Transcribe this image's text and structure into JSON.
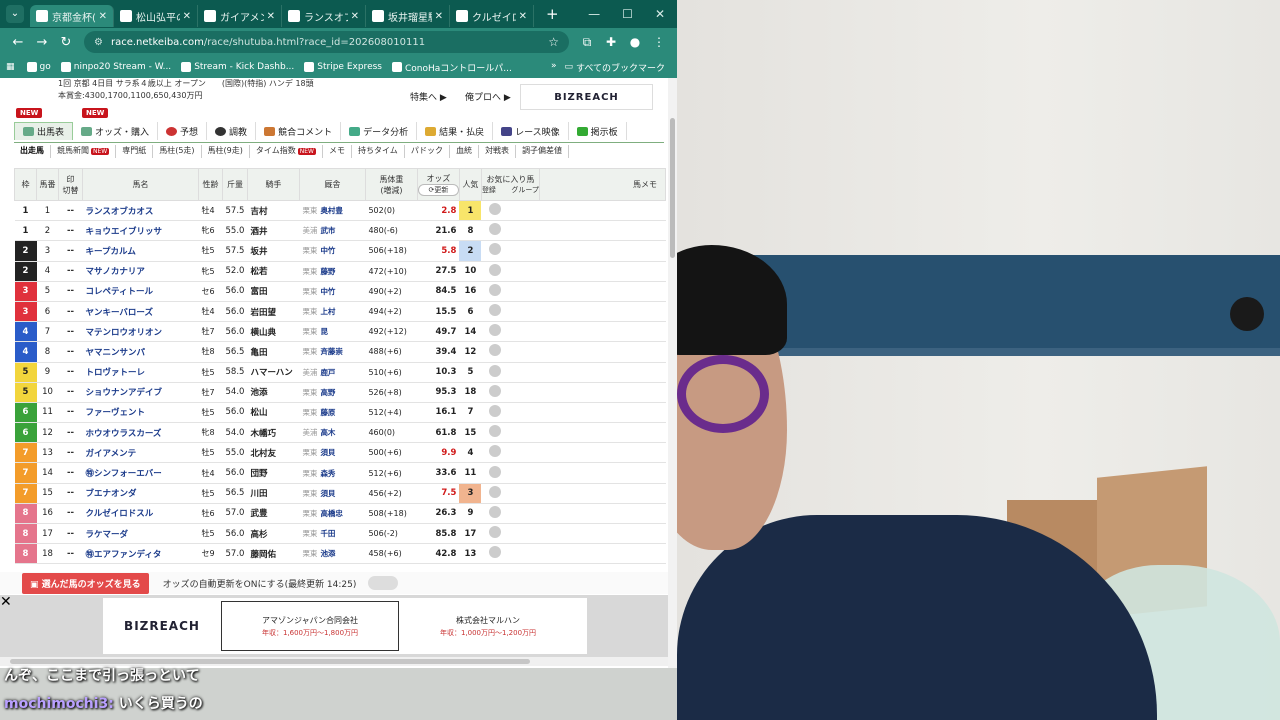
{
  "browser": {
    "tabs": [
      {
        "label": "京都金杯(G"
      },
      {
        "label": "松山弘平のS"
      },
      {
        "label": "ガイアメンテ"
      },
      {
        "label": "ランスオブカオ"
      },
      {
        "label": "坂井瑠星騎手"
      },
      {
        "label": "クルゼイロドス"
      }
    ],
    "url_host": "race.netkeiba.com",
    "url_path": "/race/shutuba.html?race_id=202608010111",
    "bookmarks": [
      {
        "label": "go"
      },
      {
        "label": "ninpo20 Stream - W..."
      },
      {
        "label": "Stream - Kick Dashb..."
      },
      {
        "label": "Stripe Express"
      },
      {
        "label": "ConoHaコントロールパ..."
      }
    ],
    "bookmarks_all": "すべてのブックマーク"
  },
  "race": {
    "info_line1": "1回 京都 4日目 サラ系４歳以上 オープン　　(国際)(特指) ハンデ 18頭",
    "info_line2": "本賞金:4300,1700,1100,650,430万円",
    "tokushu": "特集へ ▶",
    "orepro": "俺プロへ ▶",
    "ad_logo": "BIZREACH"
  },
  "menu_primary": [
    {
      "label": "出馬表"
    },
    {
      "label": "オッズ・購入"
    },
    {
      "label": "予想"
    },
    {
      "label": "調教"
    },
    {
      "label": "競合コメント"
    },
    {
      "label": "データ分析"
    },
    {
      "label": "結果・払戻"
    },
    {
      "label": "レース映像"
    },
    {
      "label": "掲示板"
    }
  ],
  "menu_secondary": [
    {
      "label": "出走馬"
    },
    {
      "label": "競馬新聞"
    },
    {
      "label": "専門紙"
    },
    {
      "label": "馬柱(5走)"
    },
    {
      "label": "馬柱(9走)"
    },
    {
      "label": "タイム指数"
    },
    {
      "label": "メモ"
    },
    {
      "label": "持ちタイム"
    },
    {
      "label": "パドック"
    },
    {
      "label": "血統"
    },
    {
      "label": "対戦表"
    },
    {
      "label": "調子偏差値"
    }
  ],
  "new_badge": "NEW",
  "headers": {
    "waku": "枠",
    "umaban": "馬番",
    "mark": "印",
    "mark_toggle": "切替",
    "name": "馬名",
    "sexage": "性齢",
    "kinryo": "斤量",
    "jockey": "騎手",
    "trainer": "厩舎",
    "weight": "馬体重",
    "weight_sub": "(増減)",
    "odds": "オッズ",
    "odds_update": "更新",
    "pop": "人気",
    "fav": "お気に入り馬",
    "fav_reg": "登録",
    "fav_group": "グループ",
    "memo": "馬メモ"
  },
  "horses": [
    {
      "waku": "1",
      "num": "1",
      "name": "ランスオブカオス",
      "sex": "牡4",
      "kg": "57.5",
      "jockey": "吉村",
      "region": "栗東",
      "trainer": "奥村豊",
      "weight": "502(0)",
      "odds": "2.8",
      "pop": "1"
    },
    {
      "waku": "1",
      "num": "2",
      "name": "キョウエイブリッサ",
      "sex": "牝6",
      "kg": "55.0",
      "jockey": "酒井",
      "region": "美浦",
      "trainer": "武市",
      "weight": "480(-6)",
      "odds": "21.6",
      "pop": "8"
    },
    {
      "waku": "2",
      "num": "3",
      "name": "キープカルム",
      "sex": "牡5",
      "kg": "57.5",
      "jockey": "坂井",
      "region": "栗東",
      "trainer": "中竹",
      "weight": "506(+18)",
      "odds": "5.8",
      "pop": "2"
    },
    {
      "waku": "2",
      "num": "4",
      "name": "マサノカナリア",
      "sex": "牝5",
      "kg": "52.0",
      "jockey": "松若",
      "region": "栗東",
      "trainer": "藤野",
      "weight": "472(+10)",
      "odds": "27.5",
      "pop": "10"
    },
    {
      "waku": "3",
      "num": "5",
      "name": "コレペティトール",
      "sex": "セ6",
      "kg": "56.0",
      "jockey": "富田",
      "region": "栗東",
      "trainer": "中竹",
      "weight": "490(+2)",
      "odds": "84.5",
      "pop": "16"
    },
    {
      "waku": "3",
      "num": "6",
      "name": "ヤンキーバローズ",
      "sex": "牡4",
      "kg": "56.0",
      "jockey": "岩田望",
      "region": "栗東",
      "trainer": "上村",
      "weight": "494(+2)",
      "odds": "15.5",
      "pop": "6"
    },
    {
      "waku": "4",
      "num": "7",
      "name": "マテンロウオリオン",
      "sex": "牡7",
      "kg": "56.0",
      "jockey": "横山典",
      "region": "栗東",
      "trainer": "昆",
      "weight": "492(+12)",
      "odds": "49.7",
      "pop": "14"
    },
    {
      "waku": "4",
      "num": "8",
      "name": "ヤマニンサンパ",
      "sex": "牡8",
      "kg": "56.5",
      "jockey": "亀田",
      "region": "栗東",
      "trainer": "斉藤崇",
      "weight": "488(+6)",
      "odds": "39.4",
      "pop": "12"
    },
    {
      "waku": "5",
      "num": "9",
      "name": "トロヴァトーレ",
      "sex": "牡5",
      "kg": "58.5",
      "jockey": "ハマーハン",
      "region": "美浦",
      "trainer": "鹿戸",
      "weight": "510(+6)",
      "odds": "10.3",
      "pop": "5"
    },
    {
      "waku": "5",
      "num": "10",
      "name": "ショウナンアデイブ",
      "sex": "牡7",
      "kg": "54.0",
      "jockey": "池添",
      "region": "栗東",
      "trainer": "高野",
      "weight": "526(+8)",
      "odds": "95.3",
      "pop": "18"
    },
    {
      "waku": "6",
      "num": "11",
      "name": "ファーヴェント",
      "sex": "牡5",
      "kg": "56.0",
      "jockey": "松山",
      "region": "栗東",
      "trainer": "藤原",
      "weight": "512(+4)",
      "odds": "16.1",
      "pop": "7"
    },
    {
      "waku": "6",
      "num": "12",
      "name": "ホウオウラスカーズ",
      "sex": "牝8",
      "kg": "54.0",
      "jockey": "木幡巧",
      "region": "美浦",
      "trainer": "高木",
      "weight": "460(0)",
      "odds": "61.8",
      "pop": "15"
    },
    {
      "waku": "7",
      "num": "13",
      "name": "ガイアメンテ",
      "sex": "牡5",
      "kg": "55.0",
      "jockey": "北村友",
      "region": "栗東",
      "trainer": "須貝",
      "weight": "500(+6)",
      "odds": "9.9",
      "pop": "4"
    },
    {
      "waku": "7",
      "num": "14",
      "name": "㊕シンフォーエバー",
      "sex": "牡4",
      "kg": "56.0",
      "jockey": "団野",
      "region": "栗東",
      "trainer": "森秀",
      "weight": "512(+6)",
      "odds": "33.6",
      "pop": "11"
    },
    {
      "waku": "7",
      "num": "15",
      "name": "ブエナオンダ",
      "sex": "牡5",
      "kg": "56.5",
      "jockey": "川田",
      "region": "栗東",
      "trainer": "須貝",
      "weight": "456(+2)",
      "odds": "7.5",
      "pop": "3"
    },
    {
      "waku": "8",
      "num": "16",
      "name": "クルゼイロドスル",
      "sex": "牡6",
      "kg": "57.0",
      "jockey": "武豊",
      "region": "栗東",
      "trainer": "高橋忠",
      "weight": "508(+18)",
      "odds": "26.3",
      "pop": "9"
    },
    {
      "waku": "8",
      "num": "17",
      "name": "ラケマーダ",
      "sex": "牡5",
      "kg": "56.0",
      "jockey": "高杉",
      "region": "栗東",
      "trainer": "千田",
      "weight": "506(-2)",
      "odds": "85.8",
      "pop": "17"
    },
    {
      "waku": "8",
      "num": "18",
      "name": "㊕エアファンディタ",
      "sex": "セ9",
      "kg": "57.0",
      "jockey": "藤岡佑",
      "region": "栗東",
      "trainer": "池添",
      "weight": "458(+6)",
      "odds": "42.8",
      "pop": "13"
    }
  ],
  "waku_colors": {
    "1": "#ffffff",
    "2": "#222222",
    "3": "#e0313c",
    "4": "#2a5cc9",
    "5": "#f2d53c",
    "6": "#3aa23a",
    "7": "#f39c2a",
    "8": "#e5758c"
  },
  "bottombar": {
    "button": "選んだ馬のオッズを見る",
    "auto_update": "オッズの自動更新をONにする(最終更新 14:25)"
  },
  "ad": {
    "logo": "BIZREACH",
    "companies": [
      {
        "name": "アマゾンジャパン合同会社",
        "salary": "年収：1,600万円〜1,800万円"
      },
      {
        "name": "株式会社マルハン",
        "salary": "年収：1,000万円〜1,200万円"
      }
    ]
  },
  "chat": {
    "line1": "んぞ、ここまで引っ張っといて",
    "user": "mochimochi3:",
    "message": "いくら買うの"
  }
}
